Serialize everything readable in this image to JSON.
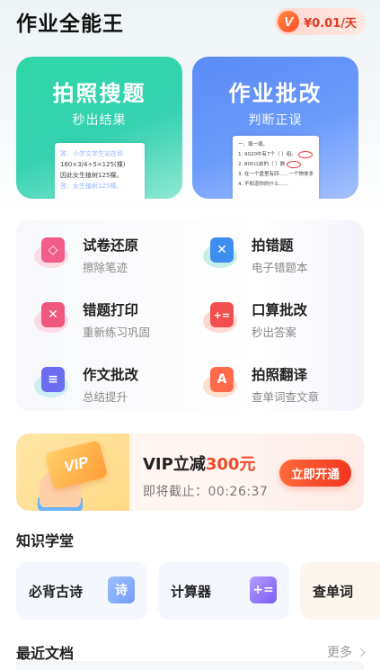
{
  "header": {
    "title": "作业全能王",
    "vip_badge": "V",
    "vip_price": "¥0.01/天"
  },
  "hero": [
    {
      "title": "拍照搜题",
      "subtitle": "秒出结果",
      "paper_lines": [
        "答：小学文学生站在圳",
        "160×3/4÷5=125(棵)",
        "因此女生植树125棵。",
        "答：女生植树125棵。"
      ]
    },
    {
      "title": "作业批改",
      "subtitle": "判断正误",
      "paper_lines": [
        "一、填一填。",
        "1. 9020中有7个（ ）组。",
        "2. 800以前的（ ）数",
        "3. 在一个盘里有四……一个物体多",
        "4. 不知道你的什么……"
      ]
    }
  ],
  "features": [
    {
      "label": "试卷还原",
      "sub": "擦除笔迹",
      "icon": "eraser-icon",
      "color": "#f25c8a",
      "blob": "#ffc1d2",
      "glyph": "◇"
    },
    {
      "label": "拍错题",
      "sub": "电子错题本",
      "icon": "error-book-icon",
      "color": "#3d8ef0",
      "blob": "#9fe0d6",
      "glyph": "✕"
    },
    {
      "label": "错题打印",
      "sub": "重新练习巩固",
      "icon": "printer-icon",
      "color": "#f0577e",
      "blob": "#ffc3d5",
      "glyph": "✕"
    },
    {
      "label": "口算批改",
      "sub": "秒出答案",
      "icon": "calculator-icon",
      "color": "#f25050",
      "blob": "#ffb9ae",
      "glyph": "+="
    },
    {
      "label": "作文批改",
      "sub": "总结提升",
      "icon": "essay-icon",
      "color": "#6b6df0",
      "blob": "#a9e6ee",
      "glyph": "≡"
    },
    {
      "label": "拍照翻译",
      "sub": "查单词查文章",
      "icon": "translate-icon",
      "color": "#ff6a4a",
      "blob": "#ffc9a8",
      "glyph": "A"
    }
  ],
  "vip_banner": {
    "card_text": "VIP",
    "line1_prefix": "VIP立减",
    "line1_amount": "300元",
    "line2": "即将截止：00:26:37",
    "button": "立即开通"
  },
  "knowledge": {
    "title": "知识学堂",
    "items": [
      {
        "label": "必背古诗",
        "icon_text": "诗",
        "icon": "poem-icon"
      },
      {
        "label": "计算器",
        "icon_text": "+=",
        "icon": "calculator-icon"
      },
      {
        "label": "查单词",
        "icon_text": "",
        "icon": ""
      }
    ]
  },
  "recent": {
    "title": "最近文档",
    "more": "更多"
  }
}
